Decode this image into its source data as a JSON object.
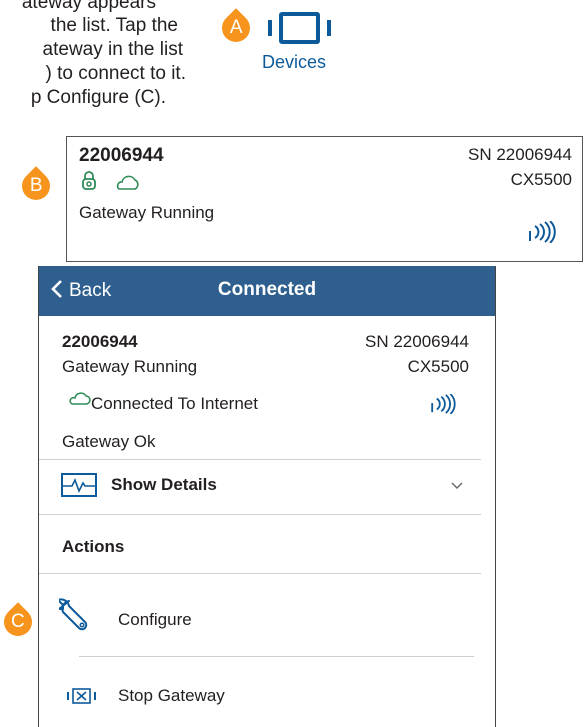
{
  "instructions": {
    "lines": [
      "ateway appears",
      "the list. Tap the",
      "ateway in the list",
      ") to connect to it.",
      "p Configure (C)."
    ]
  },
  "callouts": {
    "a": "A",
    "b": "B",
    "c": "C"
  },
  "devices_tab": {
    "label": "Devices",
    "icon": "device-tablet-icon"
  },
  "gateway_card": {
    "name": "22006944",
    "serial": "SN 22006944",
    "model": "CX5500",
    "status": "Gateway Running",
    "icons": [
      "lock-icon",
      "cloud-icon",
      "signal-icon"
    ]
  },
  "nav": {
    "back_label": "Back",
    "title": "Connected"
  },
  "detail": {
    "name": "22006944",
    "serial": "SN 22006944",
    "status": "Gateway Running",
    "model": "CX5500",
    "internet": "Connected To Internet",
    "health": "Gateway Ok",
    "show_details": "Show Details",
    "actions_header": "Actions",
    "configure": "Configure",
    "stop": "Stop Gateway"
  },
  "colors": {
    "accent_orange": "#f7941d",
    "nav_blue": "#2e5f8e",
    "link_blue": "#0d5a9a",
    "icon_green": "#2e8b57"
  }
}
